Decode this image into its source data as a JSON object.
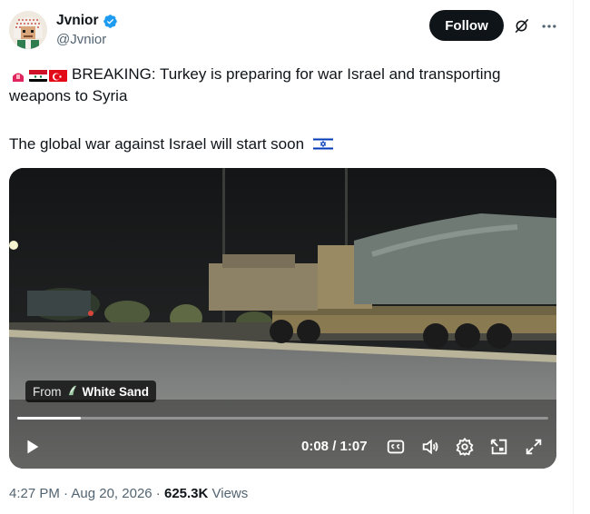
{
  "author": {
    "display_name": "Jvnior",
    "handle": "@Jvnior",
    "verified": true
  },
  "actions": {
    "follow_label": "Follow"
  },
  "tweet": {
    "emoji_flags": [
      "rotating-light",
      "syria-flag",
      "turkey-flag"
    ],
    "text_line1": "BREAKING: Turkey is preparing for war Israel and transporting weapons to Syria",
    "text_line2": "The global war against Israel will start soon",
    "trailing_emoji": "israel-flag"
  },
  "video": {
    "from_label": "From",
    "source_name": "White Sand",
    "current_time": "0:08",
    "time_separator": " / ",
    "duration": "1:07",
    "progress_fraction": 0.119
  },
  "meta": {
    "time": "4:27 PM",
    "separator1": " · ",
    "date": "Aug 20, 2026",
    "separator2": " · ",
    "views_count": "625.3K",
    "views_label": " Views"
  },
  "colors": {
    "text_primary": "#0f1419",
    "text_secondary": "#536471",
    "verified_blue": "#1d9bf0",
    "button_dark": "#0f1419"
  }
}
